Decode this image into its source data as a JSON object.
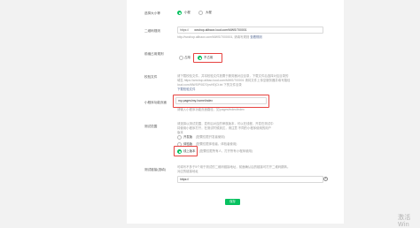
{
  "form": {
    "size": {
      "label": "选择大小等",
      "options": [
        "小程",
        "大程"
      ],
      "selected": 0
    },
    "qr_rule": {
      "label": "二维码规则",
      "prefix": "https://",
      "value": "wxshop.alibaox.loud.com/MWS/700001",
      "hint": "http://wxshop.alibaox.com/MWS/7000001, 请填写规则",
      "hint_link": "查看规则"
    },
    "prefix_match": {
      "label": "前缀占用规则",
      "options": [
        "占用",
        "不占用"
      ],
      "selected": 1
    },
    "verify_file": {
      "label": "校验文件",
      "desc": [
        "请下载校验文件，并将校验文件放置于服务器对应目录，下载文件后选择对应目录的",
        "域名 https://wxshop.alibao.loud.com/MWS/700001 请将文件上传至服务器并填写路径",
        "loud.com/MWS/P0IDT/pvHEjCt.txt 下的文件目录"
      ],
      "download_link": "下载校验文件"
    },
    "mini_page": {
      "label": "小程序功能页面",
      "value": "my-pages/my-home/index",
      "hint": "请输入小程序功能页面路径，如 pages/index/index"
    },
    "test_scope": {
      "label": "测试范围",
      "desc": [
        "请选择以测试范围，发布后对应的审核版本，可以在线程，开发在测试中",
        "将使用小程序打开，在测试时候到达，请注意 不同的小程序使用的用户",
        "版本"
      ],
      "options": [
        {
          "name": "开发版",
          "desc": "(配置仅限开发者使用)"
        },
        {
          "name": "体验版",
          "desc": "(配置仅限体验者，体验者使用)"
        },
        {
          "name": "线上版本",
          "desc": "(配置仅限所有人，打开所有小程序使用)"
        }
      ],
      "selected": 2
    },
    "test_link": {
      "label": "测试链接(选填)",
      "desc": [
        "可填写不多于5个用于测试的二维码链接地址，前面确认后的链接可打开二维码跳转。",
        "对应的链接地址"
      ],
      "value": "https://",
      "clear_icon": "×"
    },
    "submit_label": "保存"
  },
  "watermark": "激活 Win"
}
